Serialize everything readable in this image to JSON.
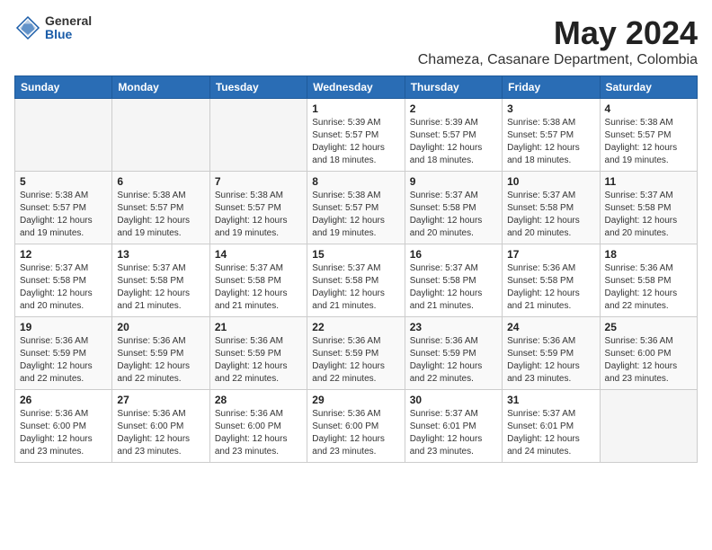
{
  "header": {
    "logo_general": "General",
    "logo_blue": "Blue",
    "month_year": "May 2024",
    "location": "Chameza, Casanare Department, Colombia"
  },
  "days_of_week": [
    "Sunday",
    "Monday",
    "Tuesday",
    "Wednesday",
    "Thursday",
    "Friday",
    "Saturday"
  ],
  "weeks": [
    [
      {
        "day": "",
        "info": ""
      },
      {
        "day": "",
        "info": ""
      },
      {
        "day": "",
        "info": ""
      },
      {
        "day": "1",
        "info": "Sunrise: 5:39 AM\nSunset: 5:57 PM\nDaylight: 12 hours and 18 minutes."
      },
      {
        "day": "2",
        "info": "Sunrise: 5:39 AM\nSunset: 5:57 PM\nDaylight: 12 hours and 18 minutes."
      },
      {
        "day": "3",
        "info": "Sunrise: 5:38 AM\nSunset: 5:57 PM\nDaylight: 12 hours and 18 minutes."
      },
      {
        "day": "4",
        "info": "Sunrise: 5:38 AM\nSunset: 5:57 PM\nDaylight: 12 hours and 19 minutes."
      }
    ],
    [
      {
        "day": "5",
        "info": "Sunrise: 5:38 AM\nSunset: 5:57 PM\nDaylight: 12 hours and 19 minutes."
      },
      {
        "day": "6",
        "info": "Sunrise: 5:38 AM\nSunset: 5:57 PM\nDaylight: 12 hours and 19 minutes."
      },
      {
        "day": "7",
        "info": "Sunrise: 5:38 AM\nSunset: 5:57 PM\nDaylight: 12 hours and 19 minutes."
      },
      {
        "day": "8",
        "info": "Sunrise: 5:38 AM\nSunset: 5:57 PM\nDaylight: 12 hours and 19 minutes."
      },
      {
        "day": "9",
        "info": "Sunrise: 5:37 AM\nSunset: 5:58 PM\nDaylight: 12 hours and 20 minutes."
      },
      {
        "day": "10",
        "info": "Sunrise: 5:37 AM\nSunset: 5:58 PM\nDaylight: 12 hours and 20 minutes."
      },
      {
        "day": "11",
        "info": "Sunrise: 5:37 AM\nSunset: 5:58 PM\nDaylight: 12 hours and 20 minutes."
      }
    ],
    [
      {
        "day": "12",
        "info": "Sunrise: 5:37 AM\nSunset: 5:58 PM\nDaylight: 12 hours and 20 minutes."
      },
      {
        "day": "13",
        "info": "Sunrise: 5:37 AM\nSunset: 5:58 PM\nDaylight: 12 hours and 21 minutes."
      },
      {
        "day": "14",
        "info": "Sunrise: 5:37 AM\nSunset: 5:58 PM\nDaylight: 12 hours and 21 minutes."
      },
      {
        "day": "15",
        "info": "Sunrise: 5:37 AM\nSunset: 5:58 PM\nDaylight: 12 hours and 21 minutes."
      },
      {
        "day": "16",
        "info": "Sunrise: 5:37 AM\nSunset: 5:58 PM\nDaylight: 12 hours and 21 minutes."
      },
      {
        "day": "17",
        "info": "Sunrise: 5:36 AM\nSunset: 5:58 PM\nDaylight: 12 hours and 21 minutes."
      },
      {
        "day": "18",
        "info": "Sunrise: 5:36 AM\nSunset: 5:58 PM\nDaylight: 12 hours and 22 minutes."
      }
    ],
    [
      {
        "day": "19",
        "info": "Sunrise: 5:36 AM\nSunset: 5:59 PM\nDaylight: 12 hours and 22 minutes."
      },
      {
        "day": "20",
        "info": "Sunrise: 5:36 AM\nSunset: 5:59 PM\nDaylight: 12 hours and 22 minutes."
      },
      {
        "day": "21",
        "info": "Sunrise: 5:36 AM\nSunset: 5:59 PM\nDaylight: 12 hours and 22 minutes."
      },
      {
        "day": "22",
        "info": "Sunrise: 5:36 AM\nSunset: 5:59 PM\nDaylight: 12 hours and 22 minutes."
      },
      {
        "day": "23",
        "info": "Sunrise: 5:36 AM\nSunset: 5:59 PM\nDaylight: 12 hours and 22 minutes."
      },
      {
        "day": "24",
        "info": "Sunrise: 5:36 AM\nSunset: 5:59 PM\nDaylight: 12 hours and 23 minutes."
      },
      {
        "day": "25",
        "info": "Sunrise: 5:36 AM\nSunset: 6:00 PM\nDaylight: 12 hours and 23 minutes."
      }
    ],
    [
      {
        "day": "26",
        "info": "Sunrise: 5:36 AM\nSunset: 6:00 PM\nDaylight: 12 hours and 23 minutes."
      },
      {
        "day": "27",
        "info": "Sunrise: 5:36 AM\nSunset: 6:00 PM\nDaylight: 12 hours and 23 minutes."
      },
      {
        "day": "28",
        "info": "Sunrise: 5:36 AM\nSunset: 6:00 PM\nDaylight: 12 hours and 23 minutes."
      },
      {
        "day": "29",
        "info": "Sunrise: 5:36 AM\nSunset: 6:00 PM\nDaylight: 12 hours and 23 minutes."
      },
      {
        "day": "30",
        "info": "Sunrise: 5:37 AM\nSunset: 6:01 PM\nDaylight: 12 hours and 23 minutes."
      },
      {
        "day": "31",
        "info": "Sunrise: 5:37 AM\nSunset: 6:01 PM\nDaylight: 12 hours and 24 minutes."
      },
      {
        "day": "",
        "info": ""
      }
    ]
  ]
}
